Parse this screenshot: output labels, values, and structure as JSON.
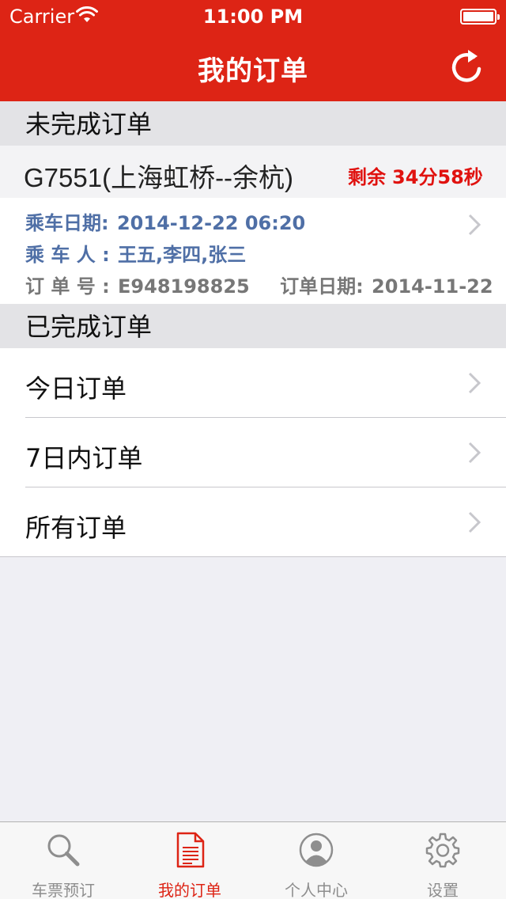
{
  "status_bar": {
    "carrier": "Carrier",
    "time": "11:00 PM"
  },
  "nav": {
    "title": "我的订单",
    "right_icon": "refresh-icon"
  },
  "colors": {
    "brand_red": "#dd2415",
    "detail_blue": "#4f6fa6",
    "remain_red": "#e0120f"
  },
  "pending": {
    "header": "未完成订单",
    "order": {
      "train": "G7551(上海虹桥--余杭)",
      "remain_label": "剩余",
      "remain_time": "34分58秒",
      "ride_date_label": "乘车日期:",
      "ride_date": "2014-12-22 06:20",
      "passengers_label": "乘 车 人 :",
      "passengers": "王五,李四,张三",
      "order_no_label": "订 单 号 :",
      "order_no": "E948198825",
      "order_date_label": "订单日期:",
      "order_date": "2014-11-22"
    }
  },
  "completed": {
    "header": "已完成订单",
    "items": [
      {
        "label": "今日订单"
      },
      {
        "label": "7日内订单"
      },
      {
        "label": "所有订单"
      }
    ]
  },
  "tabbar": {
    "tabs": [
      {
        "label": "车票预订",
        "icon": "search-icon",
        "active": false
      },
      {
        "label": "我的订单",
        "icon": "document-icon",
        "active": true
      },
      {
        "label": "个人中心",
        "icon": "person-icon",
        "active": false
      },
      {
        "label": "设置",
        "icon": "gear-icon",
        "active": false
      }
    ]
  }
}
